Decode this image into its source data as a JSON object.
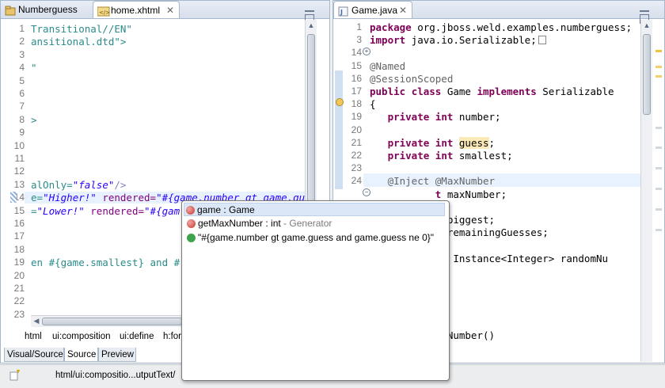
{
  "left_editor": {
    "tabs": [
      {
        "label": "Numberguess",
        "icon": "project-icon"
      },
      {
        "label": "home.xhtml",
        "icon": "xhtml-file-icon",
        "close": "✕"
      }
    ],
    "lines": [
      {
        "num": "1",
        "text": "Transitional//EN\""
      },
      {
        "num": "2",
        "text": "ansitional.dtd\">"
      },
      {
        "num": "3",
        "text": ""
      },
      {
        "num": "4",
        "text": "\""
      },
      {
        "num": "5",
        "text": ""
      },
      {
        "num": "6",
        "text": ""
      },
      {
        "num": "7",
        "text": ""
      },
      {
        "num": "8",
        "text": ">"
      },
      {
        "num": "9",
        "text": ""
      },
      {
        "num": "10",
        "text": ""
      },
      {
        "num": "11",
        "text": ""
      },
      {
        "num": "12",
        "text": ""
      },
      {
        "num": "13",
        "text": ""
      },
      {
        "num": "14",
        "text": ""
      },
      {
        "num": "15",
        "text": ""
      },
      {
        "num": "16",
        "text": ""
      },
      {
        "num": "17",
        "text": ""
      },
      {
        "num": "18",
        "text": ""
      },
      {
        "num": "19",
        "text": "en #{game.smallest} and #"
      },
      {
        "num": "20",
        "text": ""
      },
      {
        "num": "21",
        "text": ""
      },
      {
        "num": "22",
        "text": ""
      },
      {
        "num": "23",
        "text": ""
      }
    ],
    "line13": {
      "prefix": "alOnly=",
      "value": "\"false\"",
      "suffix": "/>"
    },
    "line14": {
      "prefix": "e=",
      "value": "\"Higher!\"",
      "attr": " rendered=",
      "expr": "\"#{game.number gt game.gu"
    },
    "line15": {
      "prefix": "=",
      "value": "\"Lower!\"",
      "attr": " rendered=",
      "expr": "\"#{gam"
    },
    "breadcrumb": [
      "html",
      "ui:composition",
      "ui:define",
      "h:for"
    ],
    "mode_tabs": [
      "Visual/Source",
      "Source",
      "Preview"
    ]
  },
  "right_editor": {
    "tab": {
      "label": "Game.java",
      "icon": "java-file-icon",
      "close": "✕"
    },
    "lines": [
      {
        "num": "1",
        "parts": [
          {
            "t": "package",
            "c": "kw"
          },
          {
            "t": " org.jboss.weld.examples.numberguess;",
            "c": ""
          }
        ]
      },
      {
        "num": "3",
        "parts": [
          {
            "t": "import",
            "c": "kw"
          },
          {
            "t": " java.io.Serializable;",
            "c": ""
          }
        ]
      },
      {
        "num": "14",
        "parts": []
      },
      {
        "num": "15",
        "parts": [
          {
            "t": "@Named",
            "c": "ann"
          }
        ]
      },
      {
        "num": "16",
        "parts": [
          {
            "t": "@SessionScoped",
            "c": "ann"
          }
        ]
      },
      {
        "num": "17",
        "parts": [
          {
            "t": "public",
            "c": "kw"
          },
          {
            "t": " ",
            "c": ""
          },
          {
            "t": "class",
            "c": "kw"
          },
          {
            "t": " Game ",
            "c": ""
          },
          {
            "t": "implements",
            "c": "kw"
          },
          {
            "t": " Serializable",
            "c": ""
          }
        ]
      },
      {
        "num": "18",
        "parts": [
          {
            "t": "{",
            "c": ""
          }
        ]
      },
      {
        "num": "19",
        "parts": [
          {
            "t": "   ",
            "c": ""
          },
          {
            "t": "private",
            "c": "kw"
          },
          {
            "t": " ",
            "c": ""
          },
          {
            "t": "int",
            "c": "kw"
          },
          {
            "t": " number;",
            "c": ""
          }
        ]
      },
      {
        "num": "20",
        "parts": []
      },
      {
        "num": "21",
        "parts": [
          {
            "t": "   ",
            "c": ""
          },
          {
            "t": "private",
            "c": "kw"
          },
          {
            "t": " ",
            "c": ""
          },
          {
            "t": "int",
            "c": "kw"
          },
          {
            "t": " ",
            "c": ""
          },
          {
            "t": "guess",
            "c": "guess-hl"
          },
          {
            "t": ";",
            "c": ""
          }
        ]
      },
      {
        "num": "22",
        "parts": [
          {
            "t": "   ",
            "c": ""
          },
          {
            "t": "private",
            "c": "kw"
          },
          {
            "t": " ",
            "c": ""
          },
          {
            "t": "int",
            "c": "kw"
          },
          {
            "t": " smallest;",
            "c": ""
          }
        ]
      },
      {
        "num": "23",
        "parts": []
      },
      {
        "num": "24",
        "parts": [
          {
            "t": "   @Inject @MaxNumber",
            "c": "ann"
          }
        ]
      },
      {
        "num": "",
        "parts": [
          {
            "t": "           ",
            "c": ""
          },
          {
            "t": "t",
            "c": "kw"
          },
          {
            "t": " maxNumber;",
            "c": ""
          }
        ]
      },
      {
        "num": "",
        "parts": []
      },
      {
        "num": "",
        "parts": [
          {
            "t": "           ",
            "c": ""
          },
          {
            "t": "t",
            "c": "kw"
          },
          {
            "t": " biggest;",
            "c": ""
          }
        ]
      },
      {
        "num": "",
        "parts": [
          {
            "t": "           ",
            "c": ""
          },
          {
            "t": "t",
            "c": "kw"
          },
          {
            "t": " remainingGuesses;",
            "c": ""
          }
        ]
      },
      {
        "num": "",
        "parts": []
      },
      {
        "num": "",
        "parts": [
          {
            "t": "        andom Instance<Integer> randomNu",
            "c": ""
          }
        ]
      },
      {
        "num": "",
        "parts": []
      },
      {
        "num": "",
        "parts": [
          {
            "t": "          e()",
            "c": ""
          }
        ]
      },
      {
        "num": "",
        "parts": []
      },
      {
        "num": "",
        "parts": []
      },
      {
        "num": "",
        "parts": []
      },
      {
        "num": "",
        "parts": [
          {
            "t": "          getNumber()",
            "c": ""
          }
        ]
      }
    ]
  },
  "popup": {
    "items": [
      {
        "label": "game : Game",
        "detail": "",
        "icon": "bean-icon"
      },
      {
        "label": "getMaxNumber : int",
        "detail": " - Generator",
        "icon": "bean-icon"
      },
      {
        "label": "\"#{game.number gt game.guess and game.guess ne 0}\"",
        "detail": "",
        "icon": "el-expression-icon"
      }
    ]
  },
  "status_bar": {
    "path": "html/ui:compositio...utputText/"
  },
  "colors": {
    "keyword": "#7f0055",
    "annotation": "#646464",
    "string": "#2a00ff",
    "xml_text": "#2a8b8b",
    "selection": "#dbe6f6"
  }
}
